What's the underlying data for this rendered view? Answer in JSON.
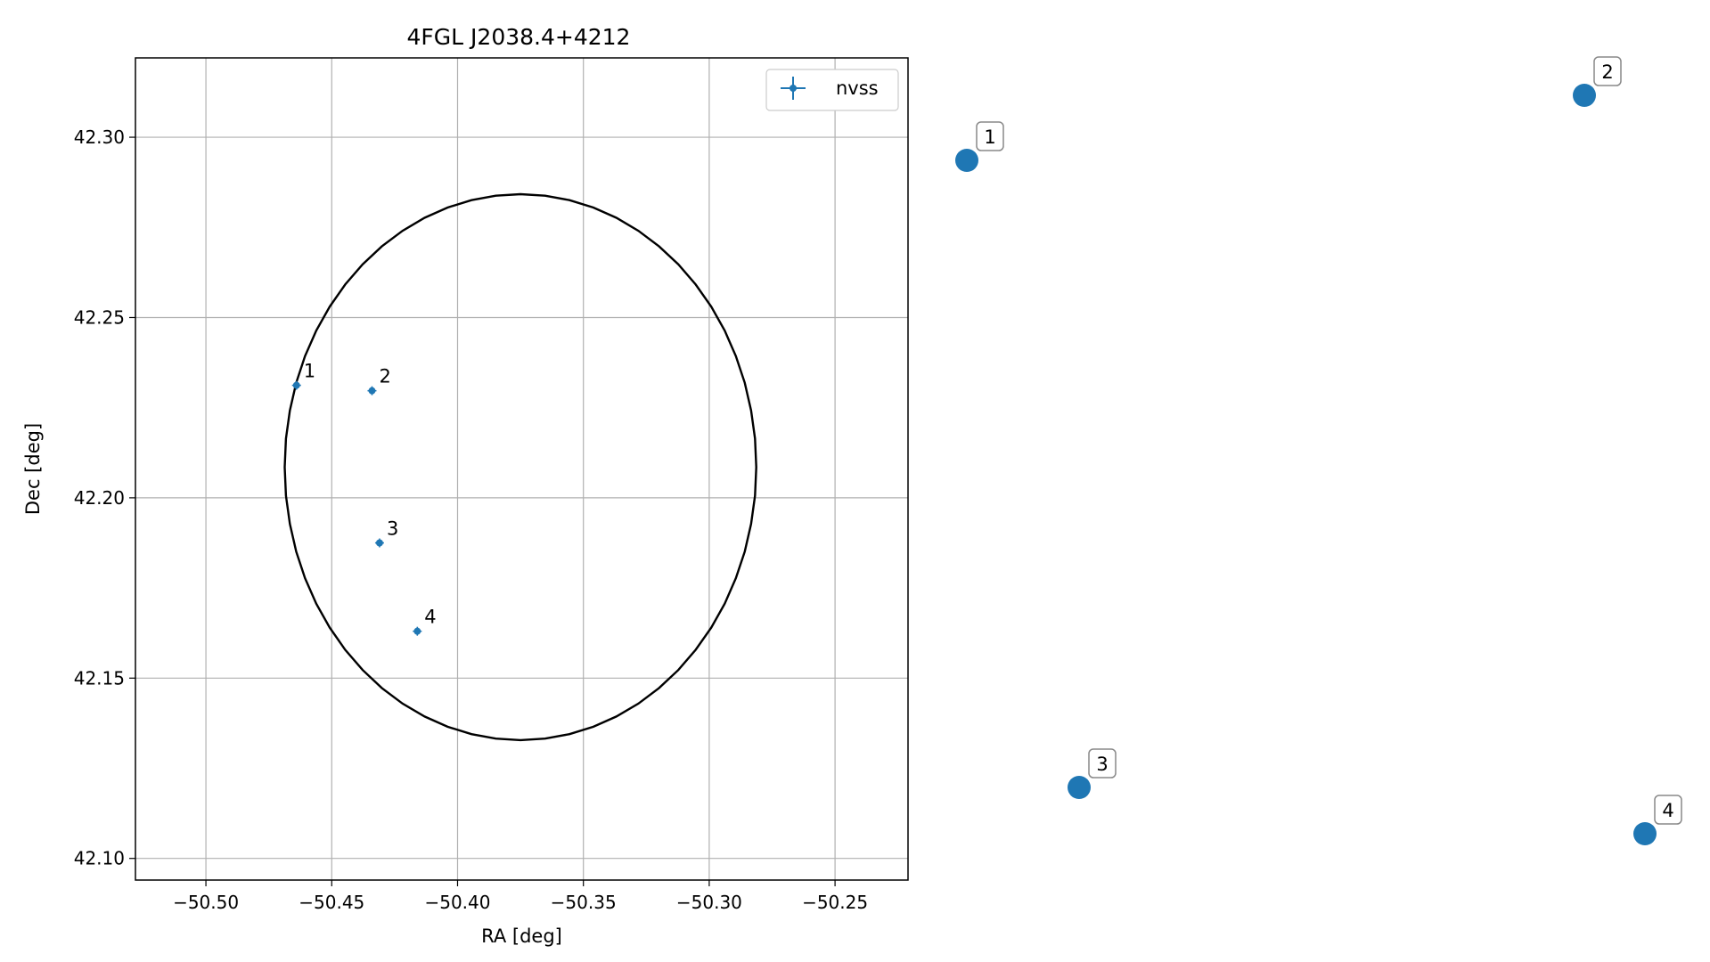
{
  "chart_data": {
    "type": "scatter",
    "title": "4FGL J2038.4+4212",
    "xlabel": "RA [deg]",
    "ylabel": "Dec [deg]",
    "xlim": [
      -50.528,
      -50.221
    ],
    "ylim": [
      42.094,
      42.322
    ],
    "xticks": [
      -50.5,
      -50.45,
      -50.4,
      -50.35,
      -50.3,
      -50.25
    ],
    "xtick_labels": [
      "−50.50",
      "−50.45",
      "−50.40",
      "−50.35",
      "−50.30",
      "−50.25"
    ],
    "yticks": [
      42.1,
      42.15,
      42.2,
      42.25,
      42.3
    ],
    "ytick_labels": [
      "42.10",
      "42.15",
      "42.20",
      "42.25",
      "42.30"
    ],
    "grid": true,
    "legend": {
      "placement": "top-right",
      "entries": [
        "nvss"
      ]
    },
    "color": "#1f77b4",
    "series": [
      {
        "name": "nvss",
        "points": [
          {
            "label": "1",
            "x": -50.464,
            "y": 42.2312
          },
          {
            "label": "2",
            "x": -50.434,
            "y": 42.2297
          },
          {
            "label": "3",
            "x": -50.431,
            "y": 42.1875
          },
          {
            "label": "4",
            "x": -50.416,
            "y": 42.163
          }
        ]
      }
    ],
    "ellipse": {
      "center_x": -50.375,
      "center_y": 42.2085,
      "semi_x": 0.0937,
      "semi_y": 0.0757,
      "color": "#000000"
    },
    "side_markers": [
      {
        "label": "1"
      },
      {
        "label": "2"
      },
      {
        "label": "3"
      },
      {
        "label": "4"
      }
    ]
  }
}
